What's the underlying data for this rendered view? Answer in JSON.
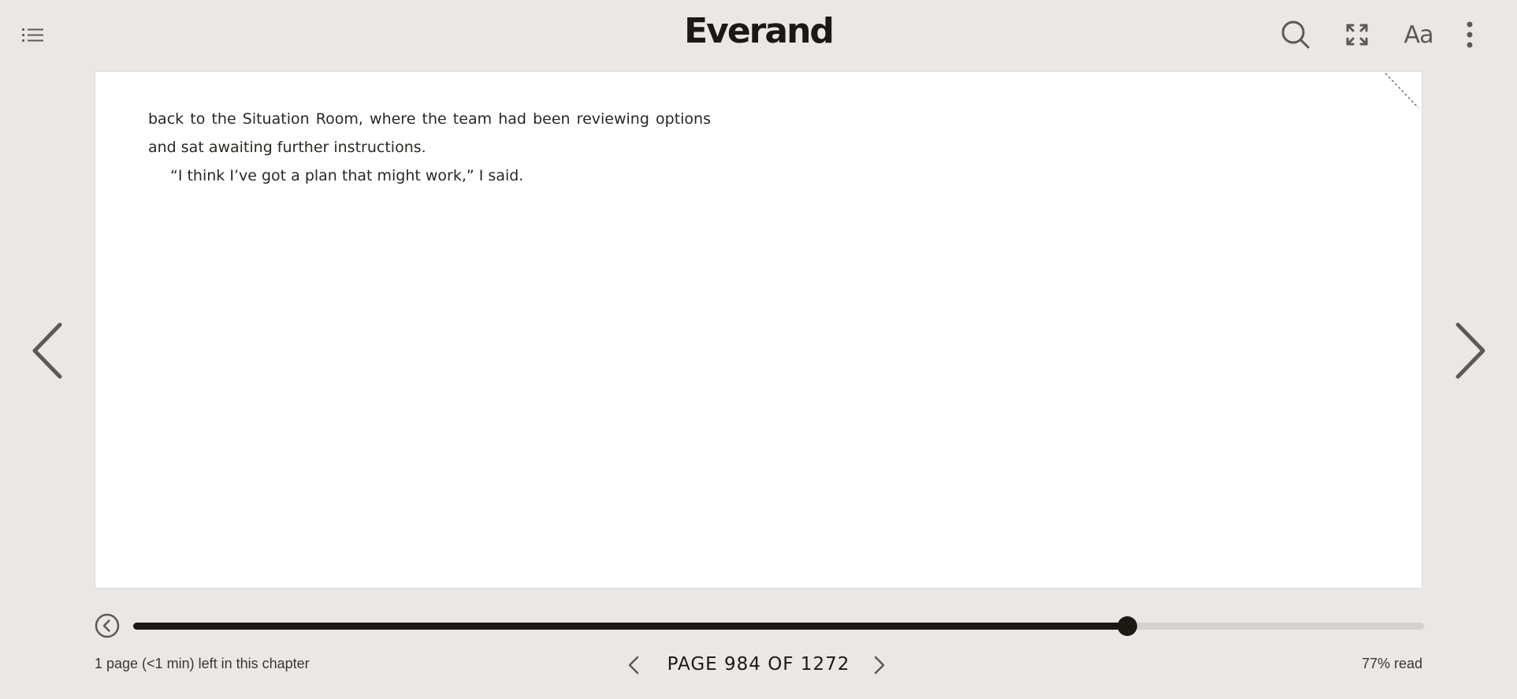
{
  "app": {
    "logo": "Everand"
  },
  "toolbar": {
    "toc_icon": "list-icon",
    "search_icon": "search-icon",
    "fullscreen_icon": "expand-icon",
    "font_settings_label": "Aa",
    "more_icon": "more-vertical-icon"
  },
  "reader": {
    "paragraphs": [
      "back to the Situation Room, where the team had been reviewing options and sat awaiting further instructions.",
      "“I think I’ve got a plan that might work,” I said."
    ]
  },
  "progress": {
    "fraction": 0.77,
    "back_icon": "chevron-left-circle-icon"
  },
  "footer": {
    "chapter_remaining": "1 page (<1 min) left in this chapter",
    "page_label": "PAGE 984 OF 1272",
    "percent_read": "77% read"
  },
  "colors": {
    "background": "#e9e8e6",
    "ink": "#1c1915",
    "page": "#ffffff",
    "track": "#d3d2cf"
  }
}
